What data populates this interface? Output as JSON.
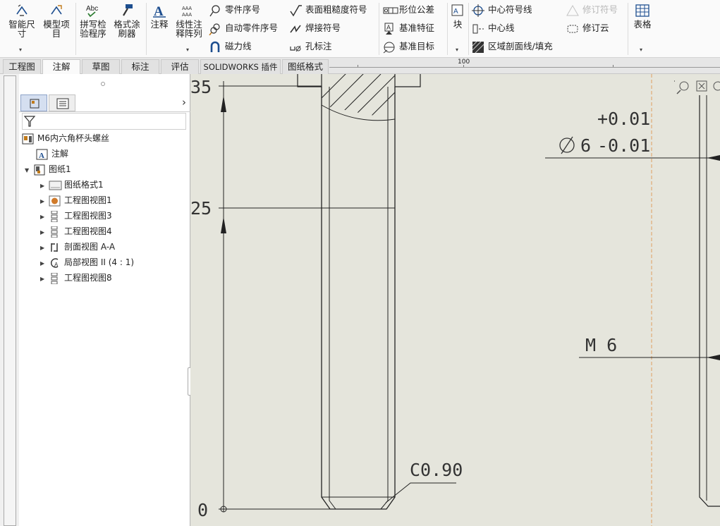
{
  "ribbon": {
    "big_buttons": [
      {
        "label1": "智能尺",
        "label2": "寸"
      },
      {
        "label1": "模型项",
        "label2": "目"
      },
      {
        "label1": "拼写检",
        "label2": "验程序"
      },
      {
        "label1": "格式涂",
        "label2": "刷器"
      },
      {
        "label1": "注释",
        "label2": ""
      },
      {
        "label1": "线性注",
        "label2": "释阵列"
      }
    ],
    "spell_icon_text": "Abc",
    "col1": [
      "零件序号",
      "自动零件序号",
      "磁力线"
    ],
    "col2": [
      "表面粗糙度符号",
      "焊接符号",
      "孔标注"
    ],
    "col3": [
      "形位公差",
      "基准特征",
      "基准目标"
    ],
    "block_label": "块",
    "col4": [
      "中心符号线",
      "中心线",
      "区域剖面线/填充"
    ],
    "col5": [
      "修订符号",
      "修订云"
    ],
    "table_label": "表格"
  },
  "tabs": [
    "工程图",
    "注解",
    "草图",
    "标注",
    "评估",
    "SOLIDWORKS 插件",
    "图纸格式"
  ],
  "active_tab": "注解",
  "ruler_label": "100",
  "tree": {
    "root": "M6内六角杯头螺丝",
    "annotations": "注解",
    "sheet": "图纸1",
    "children": [
      "图纸格式1",
      "工程图视图1",
      "工程图视图3",
      "工程图视图4",
      "剖面视图 A-A",
      "局部视图 II (4 : 1)",
      "工程图视图8"
    ]
  },
  "drawing": {
    "ord_35": "35",
    "ord_25": "25",
    "ord_0": "0",
    "tol_upper": "+0.01",
    "diameter_value": "6",
    "tol_lower": "-0.01",
    "thread_label": "M 6",
    "chamfer_label": "C0.90"
  },
  "colors": {
    "canvas_bg": "#e5e5dc",
    "centerline": "#e0a060",
    "ribbon_icon": "#1d4e8f"
  }
}
